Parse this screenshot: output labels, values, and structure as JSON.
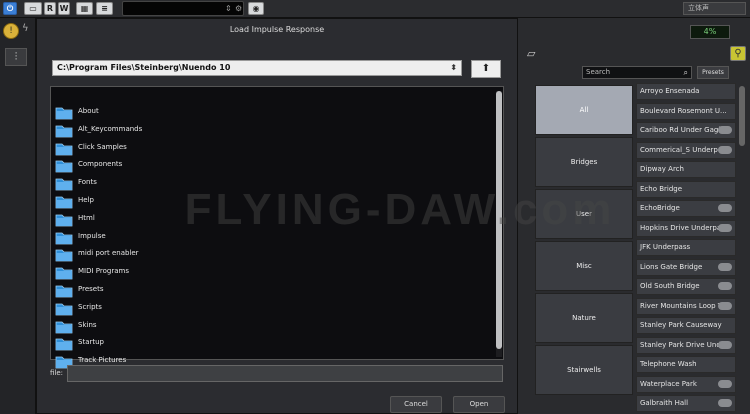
{
  "topbar": {
    "power_icon": "power-icon",
    "btn1": "R",
    "btn2": "W",
    "field_value": "",
    "dropdown_value": "立体声"
  },
  "plugin": {
    "cpu_percent": "4%",
    "search_placeholder": "Search",
    "presets_label": "Presets",
    "categories": [
      {
        "label": "All",
        "selected": true
      },
      {
        "label": "Bridges",
        "selected": false
      },
      {
        "label": "User",
        "selected": false
      },
      {
        "label": "Misc",
        "selected": false
      },
      {
        "label": "Nature",
        "selected": false
      },
      {
        "label": "Stairwells",
        "selected": false
      }
    ],
    "presets": [
      {
        "label": "Arroyo Ensenada",
        "cloud": false
      },
      {
        "label": "Boulevard Rosemont U...",
        "cloud": false
      },
      {
        "label": "Cariboo Rd Under Gagl...",
        "cloud": true
      },
      {
        "label": "Commerical_S Underp...",
        "cloud": true
      },
      {
        "label": "Dipway Arch",
        "cloud": false
      },
      {
        "label": "Echo Bridge",
        "cloud": false
      },
      {
        "label": "EchoBridge",
        "cloud": true
      },
      {
        "label": "Hopkins Drive Underpa...",
        "cloud": true
      },
      {
        "label": "JFK Underpass",
        "cloud": false
      },
      {
        "label": "Lions Gate Bridge",
        "cloud": true
      },
      {
        "label": "Old South Bridge",
        "cloud": true
      },
      {
        "label": "River Mountains Loop T...",
        "cloud": true
      },
      {
        "label": "Stanley Park Causeway",
        "cloud": false
      },
      {
        "label": "Stanley Park Drive Und...",
        "cloud": true
      },
      {
        "label": "Telephone Wash",
        "cloud": false
      },
      {
        "label": "Waterplace Park",
        "cloud": true
      },
      {
        "label": "Galbraith Hall",
        "cloud": true
      }
    ]
  },
  "dialog": {
    "title": "Load Impulse Response",
    "path": "C:\\Program Files\\Steinberg\\Nuendo 10",
    "up_icon": "up-arrow-icon",
    "folders": [
      "About",
      "Alt_Keycommands",
      "Click Samples",
      "Components",
      "Fonts",
      "Help",
      "Html",
      "Impulse",
      "midi port enabler",
      "MIDI Programs",
      "Presets",
      "Scripts",
      "Skins",
      "Startup",
      "Track Pictures"
    ],
    "file_label": "file:",
    "file_value": "",
    "cancel_label": "Cancel",
    "open_label": "Open"
  },
  "watermark": "FLYING-DAW.com",
  "colors": {
    "folder": "#2f8fd8",
    "accent_yellow": "#c9c533",
    "selected_category": "#a4a9b3"
  }
}
